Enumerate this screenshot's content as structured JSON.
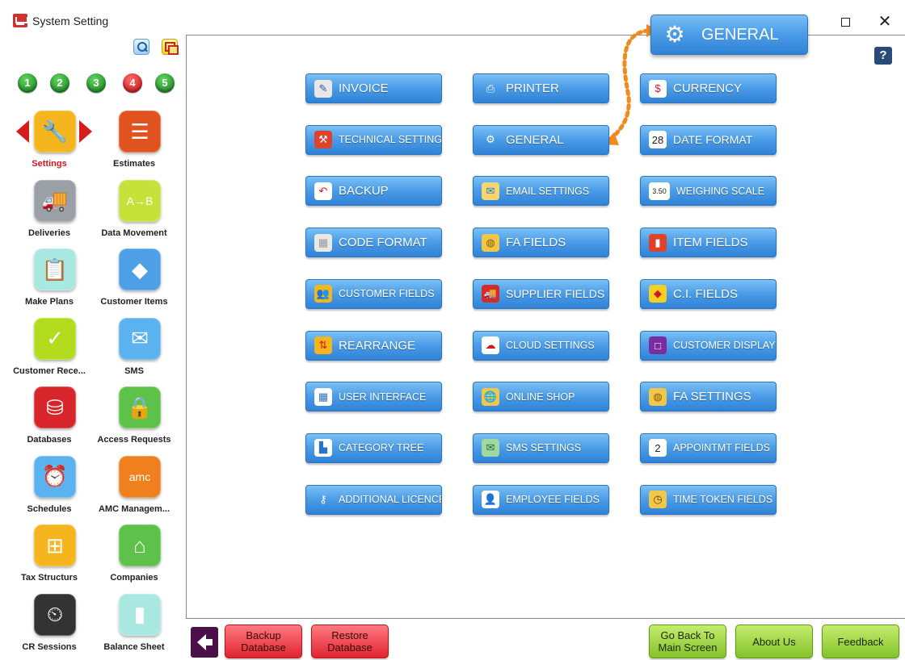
{
  "window": {
    "title": "System Setting",
    "maximize_glyph": "☐",
    "close_glyph": "✕"
  },
  "sidebar": {
    "numbers": [
      {
        "label": "1",
        "color": "#1f8f24"
      },
      {
        "label": "2",
        "color": "#1f8f24"
      },
      {
        "label": "3",
        "color": "#1f8f24"
      },
      {
        "label": "4",
        "color": "#d01414"
      },
      {
        "label": "5",
        "color": "#1f8f24"
      }
    ],
    "items": [
      {
        "label": "Settings",
        "icon": "tools-icon",
        "glyph": "🔧",
        "color": "#f5b51c",
        "active": true
      },
      {
        "label": "Estimates",
        "icon": "estimate-doc-icon",
        "glyph": "☰",
        "color": "#e0531e"
      },
      {
        "label": "Deliveries",
        "icon": "delivery-truck-icon",
        "glyph": "🚚",
        "color": "#9aa0a6"
      },
      {
        "label": "Data Movement",
        "icon": "data-move-icon",
        "glyph": "A→B",
        "color": "#c6e23a"
      },
      {
        "label": "Make Plans",
        "icon": "clipboard-check-icon",
        "glyph": "📋",
        "color": "#a9e8e0"
      },
      {
        "label": "Customer Items",
        "icon": "shapes-icon",
        "glyph": "◆",
        "color": "#4d9fe6"
      },
      {
        "label": "Customer Rece...",
        "icon": "receipt-icon",
        "glyph": "✓",
        "color": "#b4dc1e"
      },
      {
        "label": "SMS",
        "icon": "sms-mail-icon",
        "glyph": "✉",
        "color": "#5ab3ee"
      },
      {
        "label": "Databases",
        "icon": "database-icon",
        "glyph": "⛁",
        "color": "#d8252b"
      },
      {
        "label": "Access Requests",
        "icon": "user-lock-icon",
        "glyph": "🔒",
        "color": "#5ec24a"
      },
      {
        "label": "Schedules",
        "icon": "alarm-clock-icon",
        "glyph": "⏰",
        "color": "#5ab3ee"
      },
      {
        "label": "AMC Managem...",
        "icon": "amc-icon",
        "glyph": "amc",
        "color": "#f07f1e"
      },
      {
        "label": "Tax Structurs",
        "icon": "hierarchy-icon",
        "glyph": "⊞",
        "color": "#f5b51c"
      },
      {
        "label": "Companies",
        "icon": "house-icon",
        "glyph": "⌂",
        "color": "#5ec24a"
      },
      {
        "label": "CR Sessions",
        "icon": "cash-register-icon",
        "glyph": "⏲",
        "color": "#333333"
      },
      {
        "label": "Balance Sheet",
        "icon": "bar-chart-icon",
        "glyph": "▮",
        "color": "#a9e8e0"
      }
    ]
  },
  "main": {
    "callout": {
      "label": "GENERAL",
      "icon": "gear-icon",
      "glyph": "⚙"
    },
    "help_label": "?",
    "buttons": [
      [
        {
          "label": "INVOICE",
          "icon": "invoice-icon",
          "glyph": "✎",
          "icbg": "#e8e8e8",
          "icfg": "#2a5fa5"
        },
        {
          "label": "PRINTER",
          "icon": "printer-icon",
          "glyph": "⎙",
          "icbg": "transparent",
          "icfg": "#ffffff"
        },
        {
          "label": "CURRENCY",
          "icon": "currency-icon",
          "glyph": "$",
          "icbg": "#ffffff",
          "icfg": "#d0191f"
        }
      ],
      [
        {
          "label": "TECHNICAL SETTINGS",
          "icon": "technical-icon",
          "glyph": "⚒",
          "icbg": "#e0412a",
          "icfg": "#ffffff",
          "size": "small"
        },
        {
          "label": "GENERAL",
          "icon": "gear-icon",
          "glyph": "⚙",
          "icbg": "transparent",
          "icfg": "#ffffff"
        },
        {
          "label": "DATE FORMAT",
          "icon": "calendar-icon",
          "glyph": "28",
          "icbg": "#ffffff",
          "icfg": "#222222",
          "size": "mid"
        }
      ],
      [
        {
          "label": "BACKUP",
          "icon": "backup-undo-icon",
          "glyph": "↶",
          "icbg": "#ffffff",
          "icfg": "#d0191f"
        },
        {
          "label": "EMAIL SETTINGS",
          "icon": "email-icon",
          "glyph": "✉",
          "icbg": "#f6d670",
          "icfg": "#2a74c4",
          "size": "small"
        },
        {
          "label": "WEIGHING SCALE",
          "icon": "scale-icon",
          "glyph": "3.50",
          "icbg": "#ffffff",
          "icfg": "#222222",
          "size": "small"
        }
      ],
      [
        {
          "label": "CODE FORMAT",
          "icon": "grid-icon",
          "glyph": "▦",
          "icbg": "#e8e8e8",
          "icfg": "#999999"
        },
        {
          "label": "FA FIELDS",
          "icon": "coins-icon",
          "glyph": "◍",
          "icbg": "#f0c64b",
          "icfg": "#8a5a00"
        },
        {
          "label": "ITEM FIELDS",
          "icon": "item-fields-icon",
          "glyph": "▮",
          "icbg": "#e0412a",
          "icfg": "#ffffff"
        }
      ],
      [
        {
          "label": "CUSTOMER FIELDS",
          "icon": "customers-icon",
          "glyph": "👥",
          "icbg": "#f5b51c",
          "icfg": "#ffffff",
          "size": "small"
        },
        {
          "label": "SUPPLIER FIELDS",
          "icon": "truck-icon",
          "glyph": "🚚",
          "icbg": "#d62b2b",
          "icfg": "#ffffff",
          "size": "mid"
        },
        {
          "label": "C.I. FIELDS",
          "icon": "shapes-icon",
          "glyph": "◆",
          "icbg": "#f5d020",
          "icfg": "#d0191f"
        }
      ],
      [
        {
          "label": "REARRANGE",
          "icon": "rearrange-icon",
          "glyph": "⇅",
          "icbg": "#f5b51c",
          "icfg": "#d0191f"
        },
        {
          "label": "CLOUD SETTINGS",
          "icon": "cloud-icon",
          "glyph": "☁",
          "icbg": "#ffffff",
          "icfg": "#d0191f",
          "size": "small"
        },
        {
          "label": "CUSTOMER DISPLAY",
          "icon": "display-icon",
          "glyph": "□",
          "icbg": "#7a2ca0",
          "icfg": "#ffffff",
          "size": "small"
        }
      ],
      [
        {
          "label": "USER INTERFACE",
          "icon": "windows-icon",
          "glyph": "▦",
          "icbg": "#ffffff",
          "icfg": "#2a74c4",
          "size": "small"
        },
        {
          "label": "ONLINE SHOP",
          "icon": "globe-icon",
          "glyph": "🌐",
          "icbg": "#f0c64b",
          "icfg": "#8a5a00",
          "size": "small"
        },
        {
          "label": "FA SETTINGS",
          "icon": "coins-icon",
          "glyph": "◍",
          "icbg": "#f0c64b",
          "icfg": "#8a5a00"
        }
      ],
      [
        {
          "label": "CATEGORY TREE",
          "icon": "category-tree-icon",
          "glyph": "▙",
          "icbg": "#ffffff",
          "icfg": "#2a74c4",
          "size": "small"
        },
        {
          "label": "SMS SETTINGS",
          "icon": "sms-icon",
          "glyph": "✉",
          "icbg": "#9fd8a0",
          "icfg": "#1d6e2a",
          "size": "small"
        },
        {
          "label": "APPOINTMT FIELDS",
          "icon": "calendar-2-icon",
          "glyph": "2",
          "icbg": "#ffffff",
          "icfg": "#222222",
          "size": "small"
        }
      ],
      [
        {
          "label": "ADDITIONAL LICENCES",
          "icon": "key-icon",
          "glyph": "⚷",
          "icbg": "transparent",
          "icfg": "#ffffff",
          "size": "small"
        },
        {
          "label": "EMPLOYEE FIELDS",
          "icon": "employee-icon",
          "glyph": "👤",
          "icbg": "#ffffff",
          "icfg": "#555555",
          "size": "small"
        },
        {
          "label": "TIME TOKEN FIELDS",
          "icon": "clock-icon",
          "glyph": "◷",
          "icbg": "#f0c64b",
          "icfg": "#6b3d00",
          "size": "small"
        }
      ]
    ]
  },
  "bottom": {
    "backup_label": "Backup\nDatabase",
    "restore_label": "Restore\nDatabase",
    "go_back_label": "Go Back To\nMain Screen",
    "about_label": "About Us",
    "feedback_label": "Feedback"
  }
}
